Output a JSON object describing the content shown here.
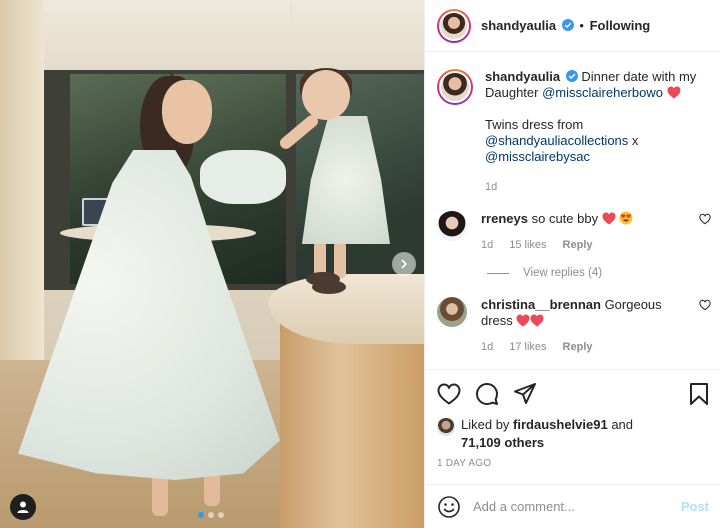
{
  "post": {
    "author": "shandyaulia",
    "header_separator": "•",
    "follow_status": "Following",
    "caption_text": "Dinner date with my Daughter",
    "caption_mention": "@missclaireherbowo",
    "caption_line2": "Twins dress from",
    "caption_mention2": "@shandyauliacollections",
    "caption_x": "x",
    "caption_mention3": "@missclairebysac",
    "caption_age": "1d",
    "carousel_index": 1,
    "carousel_count": 3
  },
  "comments": [
    {
      "username": "rreneys",
      "text": "so cute bby",
      "age": "1d",
      "likes": "15 likes",
      "reply": "Reply"
    },
    {
      "username": "christina__brennan",
      "text": "Gorgeous dress",
      "age": "1d",
      "likes": "17 likes",
      "reply": "Reply"
    }
  ],
  "view_replies": "View replies (4)",
  "likes": {
    "prefix": "Liked by",
    "user": "firdaushelvie91",
    "and": "and",
    "count": "71,109 others"
  },
  "date": "1 DAY AGO",
  "add_comment": {
    "placeholder": "Add a comment...",
    "post_label": "Post"
  },
  "colors": {
    "verified": "#3897f0",
    "heart": "#ed4956",
    "link": "#00376b",
    "post_disabled": "#b2dffc"
  }
}
